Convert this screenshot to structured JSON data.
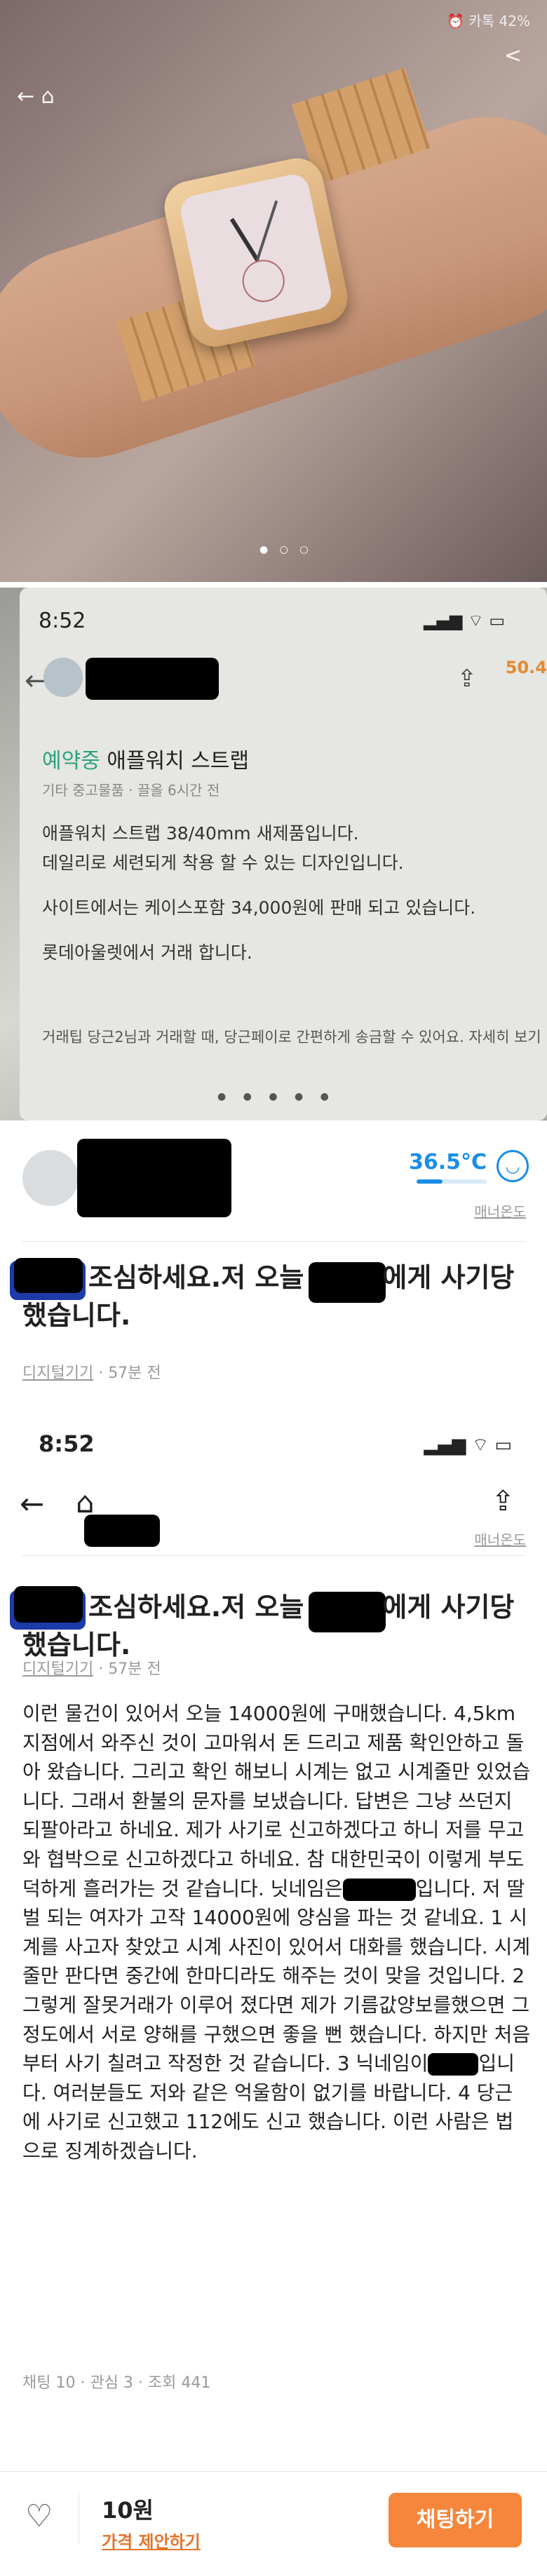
{
  "photo1": {
    "status_text": "⏰ 카톡 42%",
    "image_dots": "● ○ ○"
  },
  "listing_screenshot": {
    "time": "8:52",
    "system_icons": "▂▄▆ ⌔ ▭",
    "manner_temp_partial": "50.4",
    "title_badge": "예약중",
    "title": "애플워치 스트랩",
    "meta": "기타 중고물품 · 끌올 6시간 전",
    "description": [
      "애플워치 스트랩 38/40mm 새제품입니다.",
      "데일리로 세련되게 착용 할 수 있는 디자인입니다.",
      "사이트에서는 케이스포함 34,000원에 판매 되고 있습니다.",
      "롯데아울렛에서 거래 합니다."
    ],
    "trade_tip": "거래팁 당근2님과 거래할 때, 당근페이로 간편하게 송금할 수 있어요. 자세히 보기",
    "image_dots": "● ● ● ● ●"
  },
  "seller": {
    "temperature": "36.5°C",
    "temperature_fraction": 0.37,
    "manner_label": "매너온도"
  },
  "post": {
    "title_part1": "조심하세요.저 오늘",
    "title_part2": "에게 사기당",
    "title_line2": "했습니다.",
    "category": "디지털기기",
    "time_ago": "· 57분 전"
  },
  "app": {
    "time": "8:52",
    "back_icon": "back-arrow-icon",
    "home_icon": "home-icon",
    "share_icon": "share-icon",
    "manner_label": "매너온도"
  },
  "body": {
    "text_before_nick1": "이런 물건이 있어서 오늘 14000원에 구매했습니다. 4,5km지점에서 와주신 것이 고마워서 돈 드리고 제품 확인안하고 돌아 왔습니다. 그리고 확인 해보니 시계는 없고 시계줄만 있었습니다. 그래서  환불의 문자를 보냈습니다. 답변은 그냥 쓰던지 되팔아라고 하네요. 제가 사기로 신고하겠다고 하니 저를 무고와 협박으로 신고하겠다고 하네요. 참 대한민국이 이렇게 부도덕하게 흘러가는 것 같습니다. 닛네임은",
    "text_between_nicks": "입니다. 저 딸벌 되는 여자가 고작 14000원에 양심을 파는 것 같네요. 1 시계를 사고자 찾았고 시계 사진이 있어서 대화를 했습니다. 시계줄만 판다면 중간에 한마디라도 해주는 것이 맞을 것입니다. 2 그렇게 잘못거래가 이루어 졌다면 제가 기름값양보를했으면 그정도에서 서로 양해를 구했으면 좋을 뻔 했습니다. 하지만 처음부터 사기 칠려고 작정한 것 같습니다. 3 닉네임이",
    "text_after_nick2": "입니다. 여러분들도 저와 같은 억울함이 없기를 바랍니다. 4 당근에 사기로 신고했고 112에도 신고 했습니다. 이런 사람은 법으로 징계하겠습니다.",
    "stats": "채팅 10 · 관심 3 · 조회 441"
  },
  "bottom_bar": {
    "price": "10원",
    "negotiate_label": "가격 제안하기",
    "chat_button_label": "채팅하기"
  },
  "colors": {
    "accent_orange": "#f5863b",
    "temp_blue": "#1a8ee6",
    "reserved_green": "#2aa37e"
  }
}
